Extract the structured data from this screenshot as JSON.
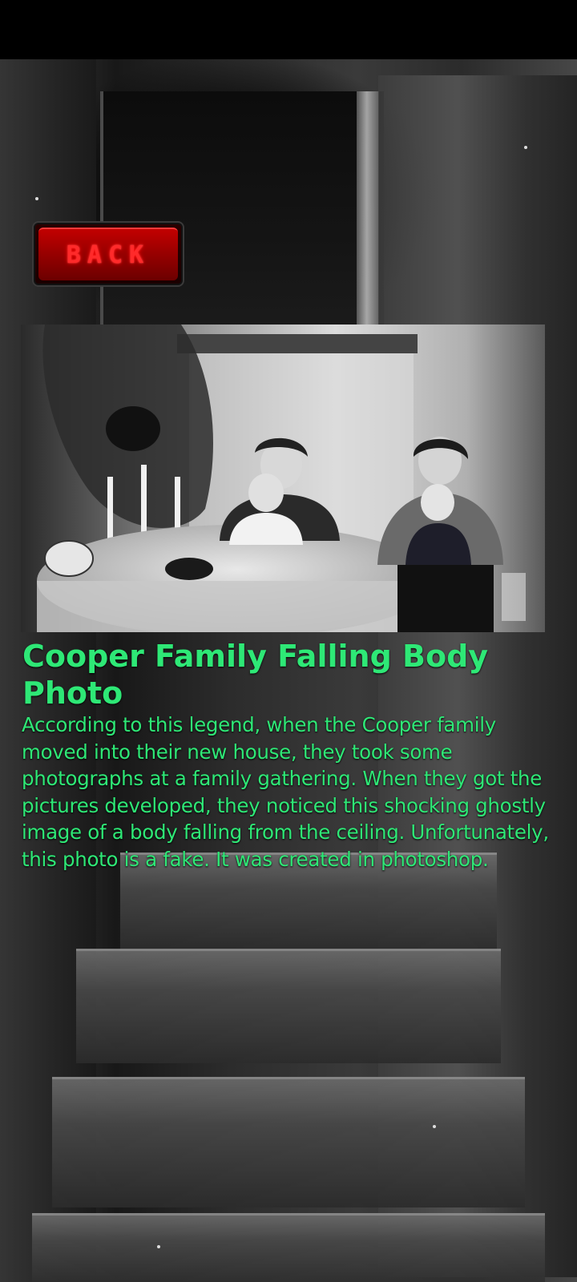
{
  "back_button": {
    "label": "BACK"
  },
  "article": {
    "title": "Cooper Family Falling Body Photo",
    "description": "According to this legend, when the Cooper family moved into their new house, they took some photographs at a family gathering. When they got the pictures developed, they noticed this shocking ghostly image of a body falling from the ceiling. Unfortunately, this photo is a fake. It was created in photoshop."
  },
  "colors": {
    "accent_text": "#2ee876",
    "back_button_red": "#c20000",
    "back_label_red": "#ff2a2a"
  }
}
